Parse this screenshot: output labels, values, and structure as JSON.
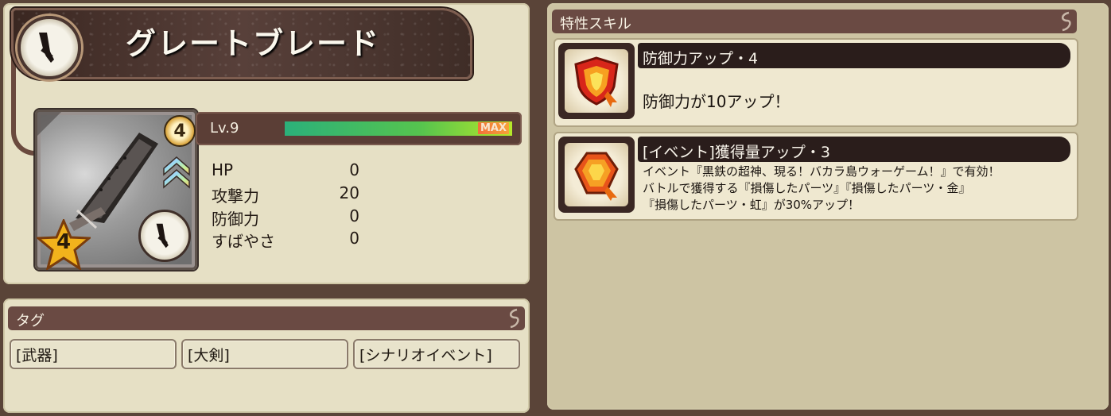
{
  "item": {
    "name": "グレートブレード",
    "level_badge": "4",
    "rarity": "4",
    "level_label": "Lv.9",
    "exp_label": "MAX",
    "exp_fraction": 1.0
  },
  "stats": [
    {
      "name": "HP",
      "value": "0"
    },
    {
      "name": "攻撃力",
      "value": "20"
    },
    {
      "name": "防御力",
      "value": "0"
    },
    {
      "name": "すばやさ",
      "value": "0"
    }
  ],
  "tags": {
    "header": "タグ",
    "items": [
      "[武器]",
      "[大剣]",
      "[シナリオイベント]"
    ]
  },
  "skills": {
    "header": "特性スキル",
    "items": [
      {
        "title": "防御力アップ・4",
        "icon": "shield-icon",
        "lines": [
          "防御力が10アップ！"
        ]
      },
      {
        "title": "[イベント]獲得量アップ・3",
        "icon": "gem-icon",
        "lines": [
          "イベント『黒鉄の超神、現る！バカラ島ウォーゲーム！』で有効！",
          "バトルで獲得する『損傷したパーツ』『損傷したパーツ・金』",
          "『損傷したパーツ・虹』が30%アップ！"
        ]
      }
    ]
  },
  "colors": {
    "panel": "#e6e0c5",
    "header": "#6a4a43",
    "exp_bar": "#56c44e",
    "skill_title": "#2a1d1b"
  }
}
